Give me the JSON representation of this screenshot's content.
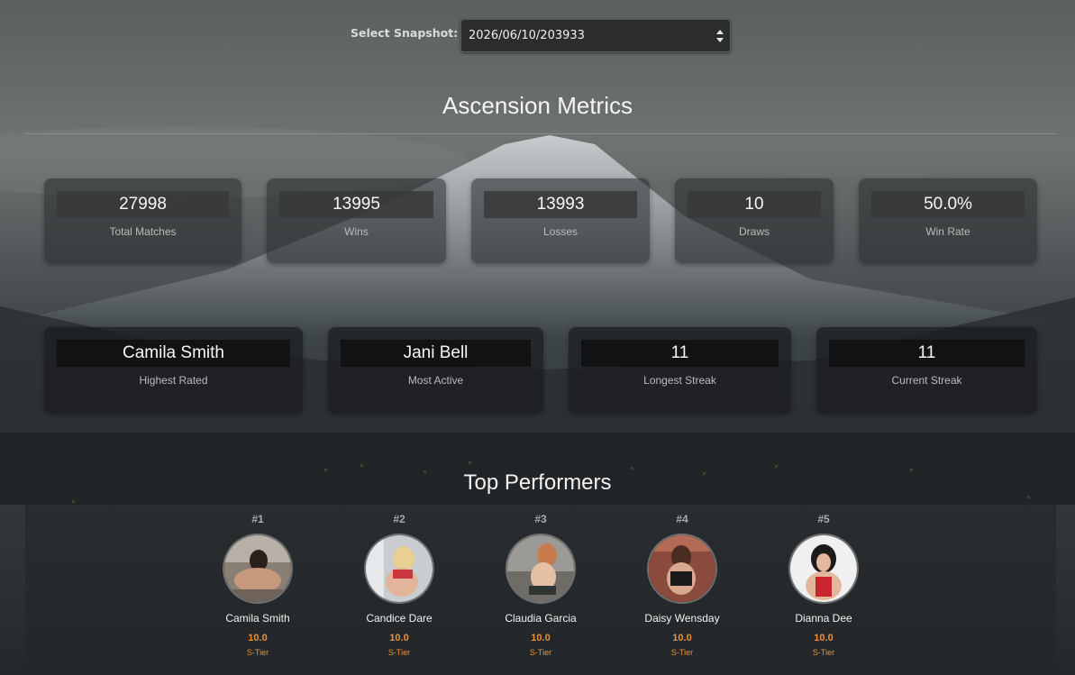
{
  "snapshot": {
    "label": "Select Snapshot:",
    "selected": "2026/06/10/203933"
  },
  "metrics": {
    "title": "Ascension Metrics",
    "row1": [
      {
        "value": "27998",
        "label": "Total Matches"
      },
      {
        "value": "13995",
        "label": "Wins"
      },
      {
        "value": "13993",
        "label": "Losses"
      },
      {
        "value": "10",
        "label": "Draws"
      },
      {
        "value": "50.0%",
        "label": "Win Rate"
      }
    ],
    "row2": [
      {
        "value": "Camila Smith",
        "label": "Highest Rated"
      },
      {
        "value": "Jani Bell",
        "label": "Most Active"
      },
      {
        "value": "11",
        "label": "Longest Streak"
      },
      {
        "value": "11",
        "label": "Current Streak"
      }
    ]
  },
  "top_performers": {
    "title": "Top Performers",
    "items": [
      {
        "rank": "#1",
        "name": "Camila Smith",
        "score": "10.0",
        "tier": "S-Tier"
      },
      {
        "rank": "#2",
        "name": "Candice Dare",
        "score": "10.0",
        "tier": "S-Tier"
      },
      {
        "rank": "#3",
        "name": "Claudia Garcia",
        "score": "10.0",
        "tier": "S-Tier"
      },
      {
        "rank": "#4",
        "name": "Daisy Wensday",
        "score": "10.0",
        "tier": "S-Tier"
      },
      {
        "rank": "#5",
        "name": "Dianna Dee",
        "score": "10.0",
        "tier": "S-Tier"
      }
    ]
  },
  "colors": {
    "accent": "#e8903a",
    "card_bg": "#2a2c2e",
    "text": "#f2f2f2"
  }
}
